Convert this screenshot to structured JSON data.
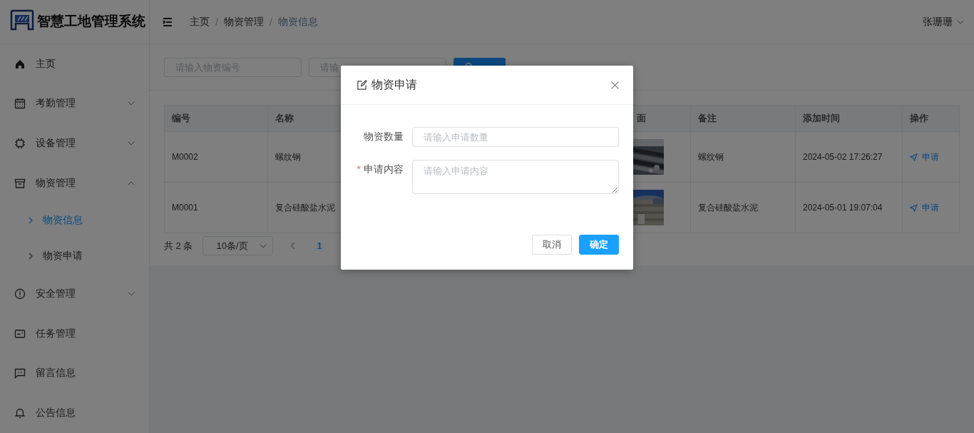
{
  "app": {
    "title": "智慧工地管理系统"
  },
  "sidebar": {
    "items": [
      {
        "label": "主页",
        "kind": "item",
        "selected": false
      },
      {
        "label": "考勤管理",
        "kind": "submenu",
        "expanded": false,
        "selected": false
      },
      {
        "label": "设备管理",
        "kind": "submenu",
        "expanded": false,
        "selected": false
      },
      {
        "label": "物资管理",
        "kind": "submenu",
        "expanded": true,
        "selected": false,
        "children": [
          {
            "label": "物资信息",
            "selected": true
          },
          {
            "label": "物资申请",
            "selected": false
          }
        ]
      },
      {
        "label": "安全管理",
        "kind": "submenu",
        "expanded": false,
        "selected": false
      },
      {
        "label": "任务管理",
        "kind": "item",
        "selected": false
      },
      {
        "label": "留言信息",
        "kind": "item",
        "selected": false
      },
      {
        "label": "公告信息",
        "kind": "item",
        "selected": false
      }
    ]
  },
  "header": {
    "breadcrumb": [
      {
        "label": "主页",
        "current": false
      },
      {
        "separator": "/",
        "label": "物资管理",
        "current": false
      },
      {
        "separator": "/",
        "label": "物资信息",
        "current": true
      }
    ],
    "user": "张珊珊"
  },
  "search": {
    "fields": [
      {
        "placeholder": "请输入物资编号"
      },
      {
        "placeholder": "请输"
      }
    ]
  },
  "table": {
    "columns": [
      "编号",
      "名称",
      "面",
      "备注",
      "添加时间",
      "操作"
    ],
    "rows": [
      {
        "code": "M0002",
        "name": "螺纹钢",
        "remark": "螺纹钢",
        "time": "2024-05-02 17:26:27",
        "action": "申请"
      },
      {
        "code": "M0001",
        "name": "复合硅酸盐水泥",
        "remark": "复合硅酸盐水泥",
        "time": "2024-05-01 19:07:04",
        "action": "申请"
      }
    ]
  },
  "pagination": {
    "total": "共 2 条",
    "page_size": "10条/页",
    "pages": [
      {
        "label": "1",
        "selected": true
      }
    ]
  },
  "dialog": {
    "title": "物资申请",
    "fields": [
      {
        "label": "物资数量",
        "kind": "input",
        "placeholder": "请输入申请数量"
      },
      {
        "required_mark": "*",
        "label": "申请内容",
        "kind": "textarea",
        "placeholder": "请输入申请内容"
      }
    ],
    "buttons": [
      {
        "label": "取消",
        "primary": false
      },
      {
        "label": "确定",
        "primary": true
      }
    ]
  }
}
